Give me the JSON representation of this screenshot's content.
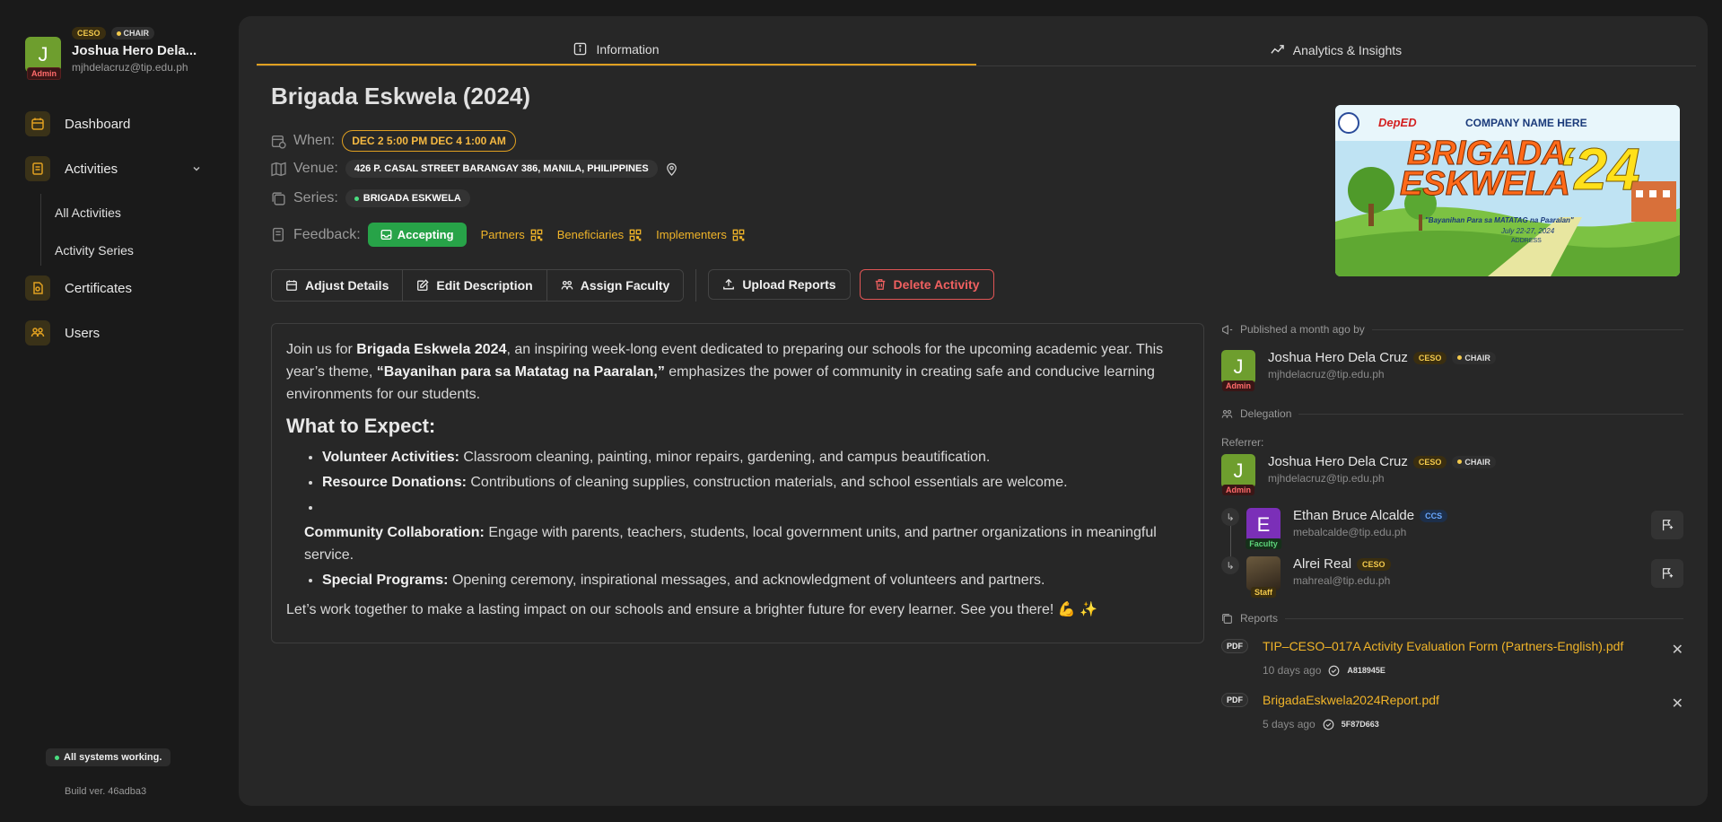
{
  "user": {
    "initial": "J",
    "role_tag": "Admin",
    "tag1": "CESO",
    "tag2": "CHAIR",
    "name": "Joshua Hero Dela...",
    "email": "mjhdelacruz@tip.edu.ph"
  },
  "nav": {
    "dashboard": "Dashboard",
    "activities": "Activities",
    "all_activities": "All Activities",
    "activity_series": "Activity Series",
    "certificates": "Certificates",
    "users": "Users"
  },
  "status": {
    "text": "All systems working.",
    "build": "Build ver. 46adba3"
  },
  "tabs": {
    "information": "Information",
    "analytics": "Analytics & Insights"
  },
  "activity": {
    "title": "Brigada Eskwela (2024)",
    "when_label": "When:",
    "when_value": "DEC 2 5:00 PM DEC 4 1:00 AM",
    "venue_label": "Venue:",
    "venue_value": "426 P. CASAL STREET BARANGAY 386, MANILA, PHILIPPINES",
    "series_label": "Series:",
    "series_value": "BRIGADA ESKWELA",
    "feedback_label": "Feedback:",
    "feedback_status": "Accepting",
    "partners": "Partners",
    "beneficiaries": "Beneficiaries",
    "implementers": "Implementers"
  },
  "actions": {
    "adjust": "Adjust Details",
    "edit": "Edit Description",
    "assign": "Assign Faculty",
    "upload": "Upload Reports",
    "delete": "Delete Activity"
  },
  "description": {
    "p1_a": "Join us for ",
    "p1_b": "Brigada Eskwela 2024",
    "p1_c": ", an inspiring week-long event dedicated to preparing our schools for the upcoming academic year. This year’s theme, ",
    "p1_d": "“Bayanihan para sa Matatag na Paaralan,”",
    "p1_e": " emphasizes the power of community in creating safe and conducive learning environments for our students.",
    "h": "What to Expect:",
    "b1_t": "Volunteer Activities:",
    "b1_d": " Classroom cleaning, painting, minor repairs, gardening, and campus beautification.",
    "b2_t": "Resource Donations:",
    "b2_d": " Contributions of cleaning supplies, construction materials, and school essentials are welcome.",
    "b3_t": "Community Collaboration:",
    "b3_d": " Engage with parents, teachers, students, local government units, and partner organizations in meaningful service.",
    "b4_t": "Special Programs:",
    "b4_d": " Opening ceremony, inspirational messages, and acknowledgment of volunteers and partners.",
    "closing": "Let’s work together to make a lasting impact on our schools and ensure a brighter future for every learner. See you there! 💪 ✨"
  },
  "cover": {
    "company": "COMPANY NAME HERE",
    "deped": "DepED",
    "line1": "BRIGADA",
    "line2": "ESKWELA",
    "year": "‘24",
    "tagline": "\"Bayanihan Para sa MATATAG na Paaralan\"",
    "dates": "July 22-27, 2024",
    "address": "ADDRESS"
  },
  "published": {
    "label": "Published a month ago by",
    "name": "Joshua Hero Dela Cruz",
    "email": "mjhdelacruz@tip.edu.ph",
    "initial": "J",
    "role": "Admin",
    "tag1": "CESO",
    "tag2": "CHAIR"
  },
  "delegation": {
    "label": "Delegation",
    "referrer_label": "Referrer:",
    "referrer": {
      "name": "Joshua Hero Dela Cruz",
      "email": "mjhdelacruz@tip.edu.ph",
      "initial": "J",
      "role": "Admin",
      "tag1": "CESO",
      "tag2": "CHAIR"
    },
    "members": [
      {
        "name": "Ethan Bruce Alcalde",
        "email": "mebalcalde@tip.edu.ph",
        "initial": "E",
        "role": "Faculty",
        "tag": "CCS"
      },
      {
        "name": "Alrei Real",
        "email": "mahreal@tip.edu.ph",
        "initial": "",
        "role": "Staff",
        "tag": "CESO"
      }
    ]
  },
  "reports": {
    "label": "Reports",
    "items": [
      {
        "type": "PDF",
        "name": "TIP–CESO–017A Activity Evaluation Form (Partners-English).pdf",
        "time": "10 days ago",
        "code": "A818945E"
      },
      {
        "type": "PDF",
        "name": "BrigadaEskwela2024Report.pdf",
        "time": "5 days ago",
        "code": "5F87D663"
      }
    ]
  }
}
